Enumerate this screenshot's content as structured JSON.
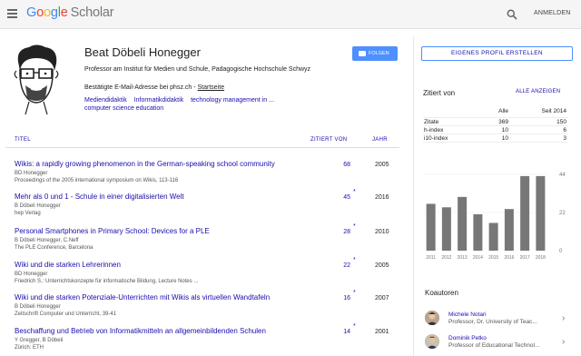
{
  "header": {
    "logo_google": [
      "G",
      "o",
      "o",
      "g",
      "l",
      "e"
    ],
    "logo_scholar": "Scholar",
    "signin": "ANMELDEN"
  },
  "profile": {
    "name": "Beat Döbeli Honegger",
    "affiliation": "Professor am Institut für Medien und Schule, Padagogische Hochschule Schwyz",
    "email": "Bestätigte E-Mail-Adresse bei phsz.ch",
    "email_sep": " - ",
    "homepage": "Startseite",
    "interests": [
      "Mediendidaktik",
      "Informatikdidaktik",
      "technology management in ...",
      "computer science education"
    ],
    "follow": "FOLGEN"
  },
  "table": {
    "col_title": "TITEL",
    "col_cited": "ZITIERT VON",
    "col_year": "JAHR",
    "rows": [
      {
        "title": "Wikis: a rapidly growing phenomenon in the German-speaking school community",
        "authors": "BD Honegger",
        "venue": "Proceedings of the 2005 international symposium on Wikis, 113-116",
        "cites": "68",
        "star": "",
        "year": "2005"
      },
      {
        "title": "Mehr als 0 und 1 - Schule in einer digitalisierten Welt",
        "authors": "B Döbeli Honegger",
        "venue": "hep Verlag",
        "cites": "45",
        "star": "*",
        "year": "2016"
      },
      {
        "title": "Personal Smartphones in Primary School: Devices for a PLE",
        "authors": "B Döbeli Honegger, C.Neff",
        "venue": "The PLE Conference, Barcelona",
        "cites": "28",
        "star": "*",
        "year": "2010"
      },
      {
        "title": "Wiki und die starken Lehrerinnen",
        "authors": "BD Honegger",
        "venue": "Friedrich S.: Unterrichtskonzepte für informatische Bildung, Lecture Notes ...",
        "cites": "22",
        "star": "*",
        "year": "2005"
      },
      {
        "title": "Wiki und die starken Potenziale-Unterrichten mit Wikis als virtuellen Wandtafeln",
        "authors": "B Döbeli Honegger",
        "venue": "Zeitschrift Computer und Unterricht, 39-41",
        "cites": "16",
        "star": "*",
        "year": "2007"
      },
      {
        "title": "Beschaffung und Betrieb von Informatikmitteln an allgemeinbildenden Schulen",
        "authors": "Y Gregger, B Döbeli",
        "venue": "Zürich: ETH",
        "cites": "14",
        "star": "*",
        "year": "2001"
      }
    ]
  },
  "sidebar": {
    "create_profile": "EIGENES PROFIL ERSTELLEN",
    "cited_by": "Zitiert von",
    "show_all": "ALLE ANZEIGEN",
    "stats_header": [
      "",
      "Alle",
      "Seit 2014"
    ],
    "stats": [
      {
        "label": "Zitate",
        "all": "369",
        "since": "150"
      },
      {
        "label": "h-index",
        "all": "10",
        "since": "6"
      },
      {
        "label": "i10-index",
        "all": "10",
        "since": "3"
      }
    ],
    "coauthors_title": "Koautoren",
    "coauthors": [
      {
        "name": "Michele Notari",
        "desc": "Professor, Dr. University of Teac..."
      },
      {
        "name": "Dominik Petko",
        "desc": "Professor of Educational Technol..."
      }
    ]
  },
  "chart_data": {
    "type": "bar",
    "categories": [
      "2011",
      "2012",
      "2013",
      "2014",
      "2015",
      "2016",
      "2017",
      "2018"
    ],
    "values": [
      27,
      25,
      31,
      21,
      16,
      24,
      43,
      43
    ],
    "yticks": [
      "44",
      "22",
      "0"
    ],
    "ylim": [
      0,
      44
    ],
    "color": "#777777"
  }
}
